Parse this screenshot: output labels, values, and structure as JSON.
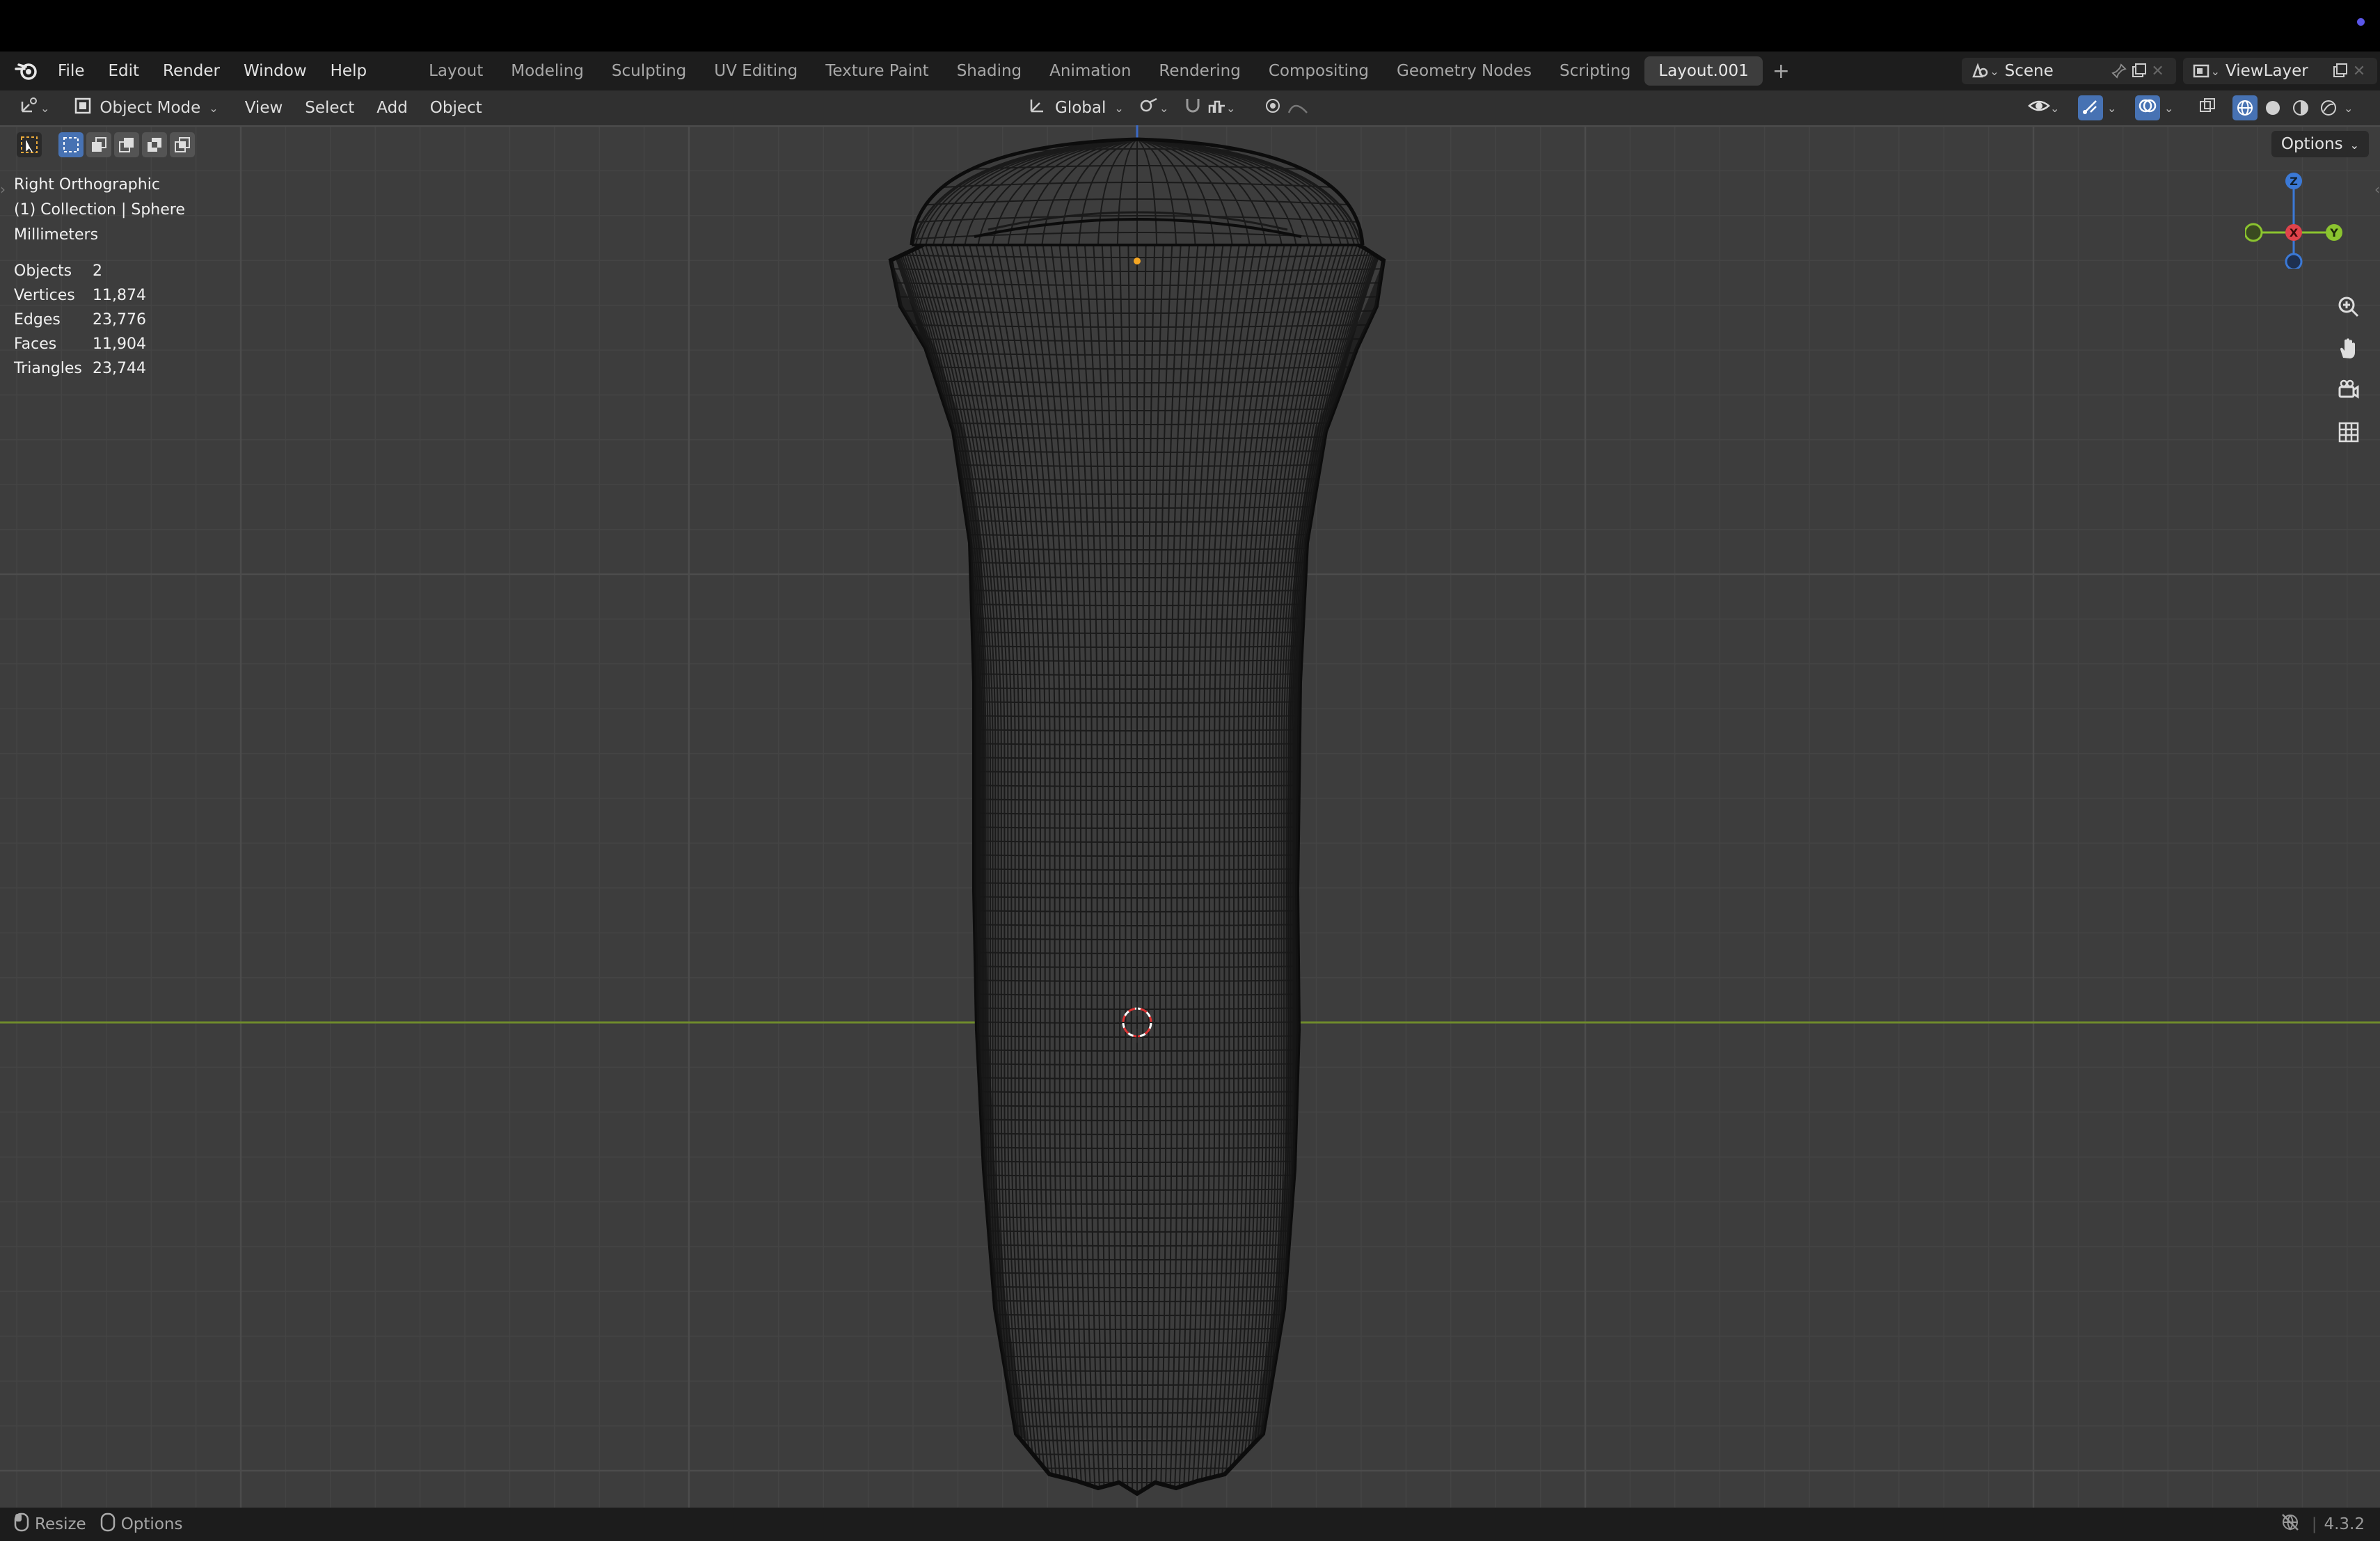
{
  "menubar": {
    "items": [
      "File",
      "Edit",
      "Render",
      "Window",
      "Help"
    ],
    "workspaces": [
      "Layout",
      "Modeling",
      "Sculpting",
      "UV Editing",
      "Texture Paint",
      "Shading",
      "Animation",
      "Rendering",
      "Compositing",
      "Geometry Nodes",
      "Scripting",
      "Layout.001"
    ],
    "active_workspace": "Layout.001",
    "scene": "Scene",
    "view_layer": "ViewLayer"
  },
  "header": {
    "mode": "Object Mode",
    "menus": [
      "View",
      "Select",
      "Add",
      "Object"
    ],
    "orientation": "Global"
  },
  "viewport": {
    "view_name": "Right Orthographic",
    "collection_info": "(1) Collection | Sphere",
    "units": "Millimeters",
    "stats": [
      {
        "label": "Objects",
        "value": "2"
      },
      {
        "label": "Vertices",
        "value": "11,874"
      },
      {
        "label": "Edges",
        "value": "23,776"
      },
      {
        "label": "Faces",
        "value": "11,904"
      },
      {
        "label": "Triangles",
        "value": "23,744"
      }
    ],
    "options_label": "Options",
    "gizmo": {
      "z": "Z",
      "x": "X",
      "y": "Y"
    }
  },
  "status": {
    "resize": "Resize",
    "options": "Options",
    "version": "4.3.2"
  },
  "colors": {
    "accent_blue": "#4772b3",
    "axis_x": "#e0434b",
    "axis_y": "#8bc42f",
    "axis_z": "#3b79d6",
    "origin_dot": "#f5a623"
  }
}
